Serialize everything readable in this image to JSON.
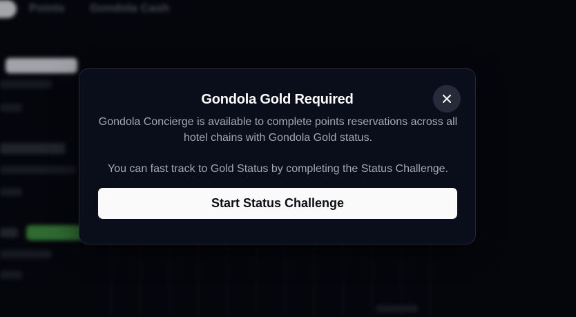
{
  "background": {
    "tabs": [
      {
        "label": ""
      },
      {
        "label": "Points"
      },
      {
        "label": "Gondola Cash"
      }
    ]
  },
  "modal": {
    "title": "Gondola Gold Required",
    "body": "Gondola Concierge is available to complete points reservations across all hotel chains with Gondola Gold status.",
    "note": "You can fast track to Gold Status by completing the Status Challenge.",
    "cta_label": "Start Status Challenge",
    "close_icon": "close-icon"
  },
  "colors": {
    "modal_bg": "#0a0d1a",
    "cta_bg": "#fafafa",
    "close_bg": "#272a39",
    "status_green": "#3e8c3e"
  }
}
